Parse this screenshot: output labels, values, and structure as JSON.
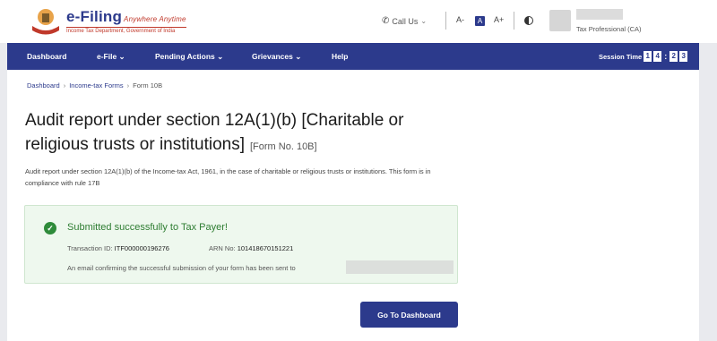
{
  "header": {
    "logo_title": "e-Filing",
    "logo_tagline": "Anywhere Anytime",
    "logo_subtitle": "Income Tax Department, Government of India",
    "call_us": "Call Us",
    "font_decrease": "A-",
    "font_default": "A",
    "font_increase": "A+",
    "user_role": "Tax Professional (CA)"
  },
  "nav": {
    "items": [
      "Dashboard",
      "e-File ⌄",
      "Pending Actions ⌄",
      "Grievances ⌄",
      "Help"
    ],
    "session_label": "Session Time",
    "session_digits": [
      "1",
      "4",
      "2",
      "3"
    ]
  },
  "breadcrumb": [
    "Dashboard",
    "Income-tax Forms",
    "Form 10B"
  ],
  "page": {
    "title": "Audit report under section 12A(1)(b) [Charitable or religious trusts or institutions]",
    "form_no": "[Form No. 10B]",
    "description": "Audit report under section 12A(1)(b) of the Income-tax Act, 1961, in the case of charitable or religious trusts or institutions. This form is in compliance with rule 17B"
  },
  "success": {
    "title": "Submitted successfully to Tax Payer!",
    "transaction_label": "Transaction ID:",
    "transaction_id": "ITF000000196276",
    "arn_label": "ARN No:",
    "arn_no": "101418670151221",
    "email_text": "An email confirming the successful submission of your form has been sent to"
  },
  "buttons": {
    "go_to_dashboard": "Go To Dashboard"
  },
  "colors": {
    "brand": "#2c3a8c",
    "success": "#2e7d32",
    "success_bg": "#eef8ee"
  }
}
